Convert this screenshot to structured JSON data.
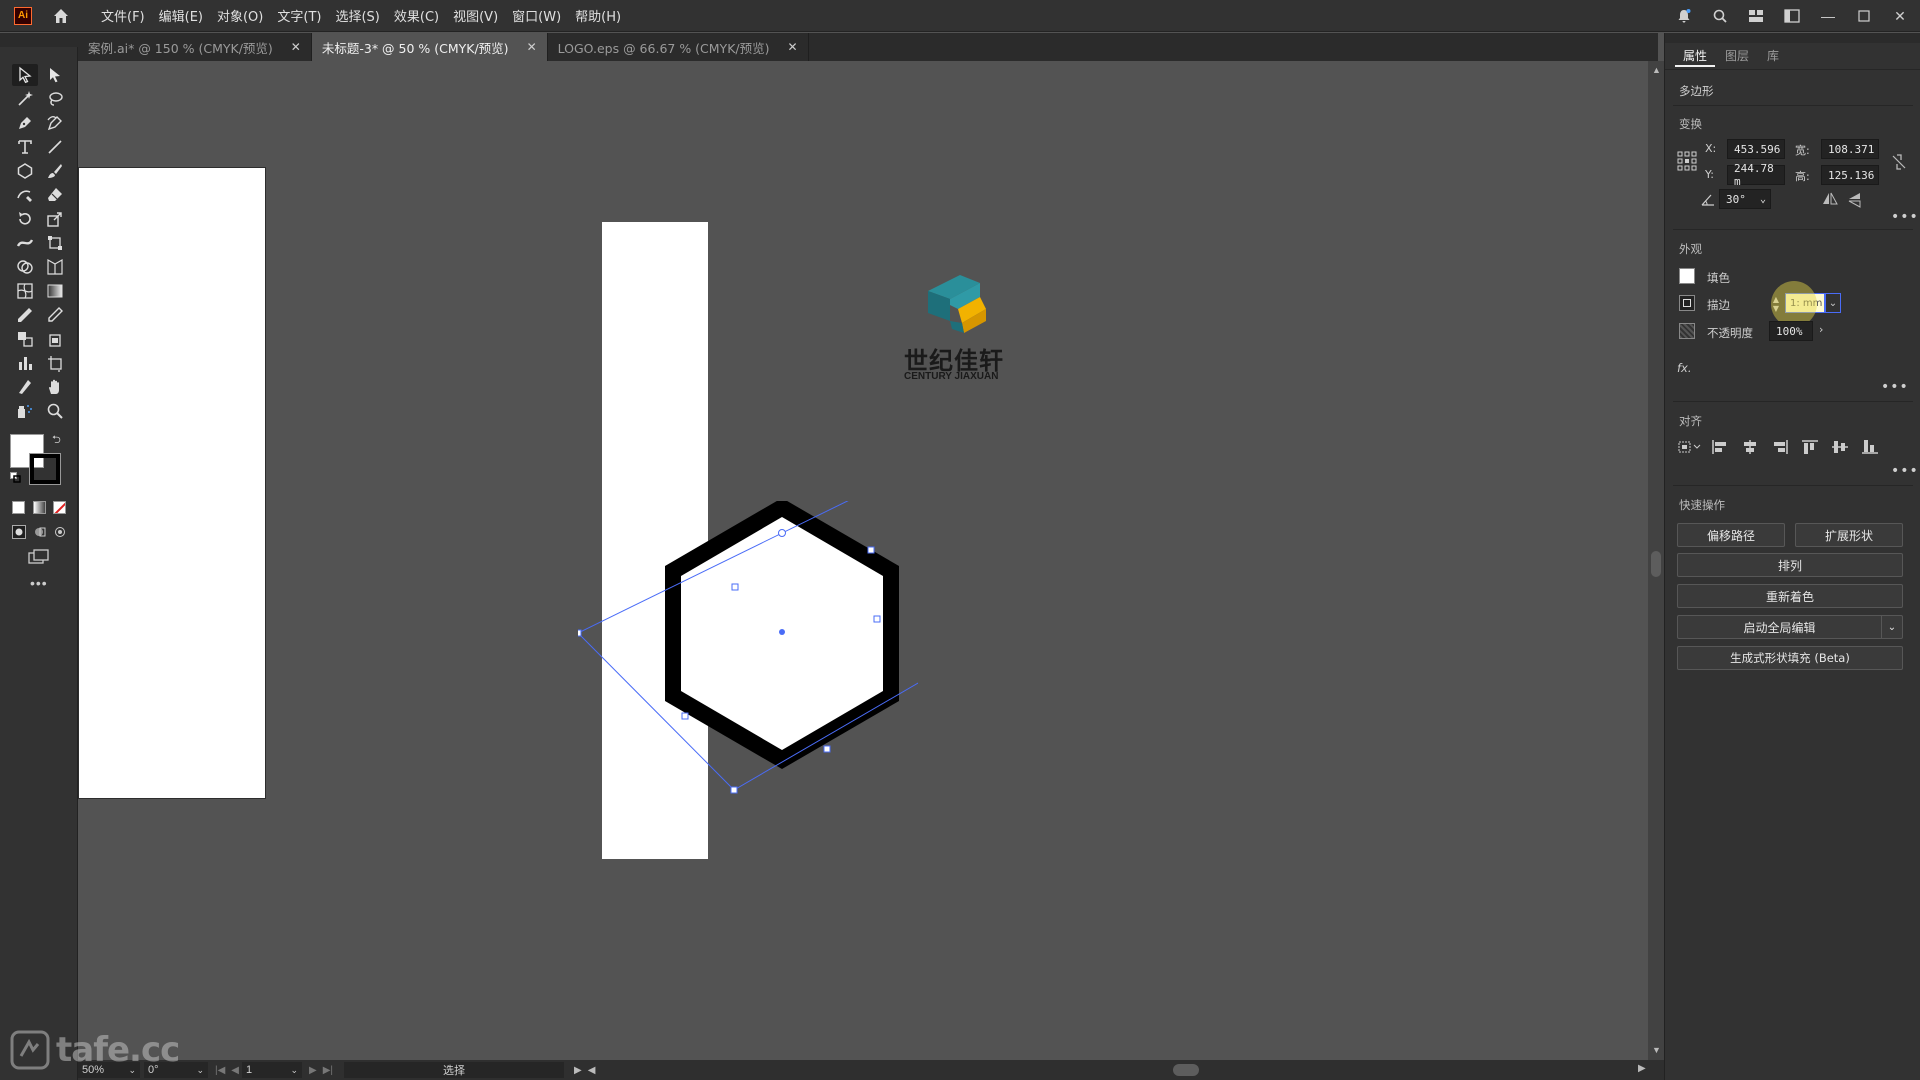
{
  "app": {
    "logo": "Ai"
  },
  "menu": [
    "文件(F)",
    "编辑(E)",
    "对象(O)",
    "文字(T)",
    "选择(S)",
    "效果(C)",
    "视图(V)",
    "窗口(W)",
    "帮助(H)"
  ],
  "tabs": [
    {
      "label": "案例.ai* @ 150 % (CMYK/预览)",
      "active": false
    },
    {
      "label": "未标题-3* @ 50 % (CMYK/预览)",
      "active": true
    },
    {
      "label": "LOGO.eps @ 66.67 % (CMYK/预览)",
      "active": false
    }
  ],
  "canvas": {
    "logo_cn": "世纪佳轩",
    "logo_en": "CENTURY JIAXUAN"
  },
  "statusbar": {
    "zoom": "50%",
    "rotation": "0°",
    "artboard": "1",
    "tool_status": "选择"
  },
  "panel": {
    "tabs": [
      "属性",
      "图层",
      "库"
    ],
    "object_type": "多边形",
    "transform": {
      "title": "变换",
      "x_label": "X:",
      "x_value": "453.596",
      "y_label": "Y:",
      "y_value": "244.78 m",
      "w_label": "宽:",
      "w_value": "108.371",
      "h_label": "高:",
      "h_value": "125.136",
      "angle_value": "30°"
    },
    "appearance": {
      "title": "外观",
      "fill_label": "填色",
      "stroke_label": "描边",
      "stroke_value": "1: mm",
      "opacity_label": "不透明度",
      "opacity_value": "100%",
      "fx_label": "fx."
    },
    "align": {
      "title": "对齐"
    },
    "quick_actions": {
      "title": "快速操作",
      "offset_path": "偏移路径",
      "expand_shape": "扩展形状",
      "arrange": "排列",
      "recolor": "重新着色",
      "global_edit": "启动全局编辑",
      "generative_fill": "生成式形状填充 (Beta)"
    }
  },
  "watermark": "tafe.cc",
  "colors": {
    "accent": "#4a6cf7",
    "canvas": "#535353",
    "panel": "#323232"
  }
}
